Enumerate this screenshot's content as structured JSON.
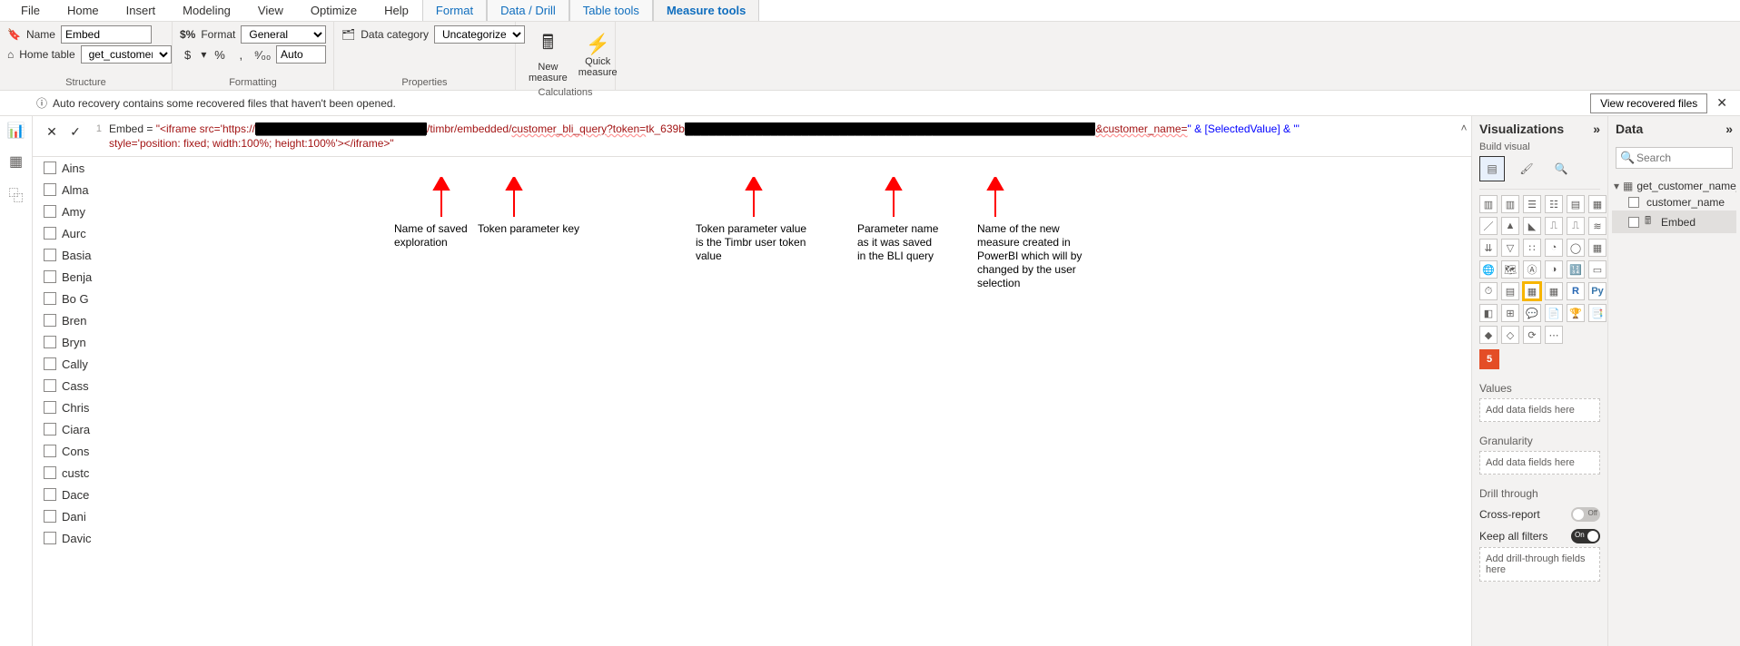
{
  "ribbon_tabs": {
    "file": "File",
    "home": "Home",
    "insert": "Insert",
    "modeling": "Modeling",
    "view": "View",
    "optimize": "Optimize",
    "help": "Help",
    "format": "Format",
    "data_drill": "Data / Drill",
    "table_tools": "Table tools",
    "measure_tools": "Measure tools"
  },
  "structure": {
    "name_label": "Name",
    "name_value": "Embed",
    "home_table_label": "Home table",
    "home_table_value": "get_customer_nam…",
    "group": "Structure"
  },
  "formatting": {
    "format_label": "Format",
    "format_value": "General",
    "currency": "$",
    "percent": "%",
    "comma": ",",
    "thousands": "⁹⁄₀₀",
    "decimals": "Auto",
    "group": "Formatting"
  },
  "properties": {
    "data_category_label": "Data category",
    "data_category_value": "Uncategorized",
    "group": "Properties"
  },
  "calculations": {
    "new_measure": "New\nmeasure",
    "quick_measure": "Quick\nmeasure",
    "group": "Calculations"
  },
  "recovery": {
    "msg": "Auto recovery contains some recovered files that haven't been opened.",
    "btn": "View recovered files"
  },
  "formula": {
    "line_no": "1",
    "prefix": "Embed = ",
    "str1": "\"<iframe src='https://",
    "redact1": "██████████████████████",
    "str2": "/timbr/embedded/",
    "str3": "customer_bli_query",
    "str4": "?token=",
    "str5": "tk_639b",
    "redact2": "█████████████████████████████████████████████████████",
    "str6": "&customer_name=",
    "str7": "\" & [SelectedValue] & \"'",
    "line2": "style='position: fixed; width:100%; height:100%'></iframe>\""
  },
  "annotations": {
    "a1": "Name of saved\nexploration",
    "a2": "Token parameter key",
    "a3": "Token parameter value\nis the Timbr user token\nvalue",
    "a4": "Parameter name\nas it was saved\nin the BLI query",
    "a5": "Name of the new\nmeasure created in\nPowerBI which will by\nchanged by the user\nselection"
  },
  "slicer_items": [
    "Ains",
    "Alma",
    "Amy",
    "Aurc",
    "Basia",
    "Benja",
    "Bo G",
    "Bren",
    "Bryn",
    "Cally",
    "Cass",
    "Chris",
    "Ciara",
    "Cons",
    "custc",
    "Dace",
    "Dani",
    "Davic"
  ],
  "viz": {
    "title": "Visualizations",
    "sub": "Build visual",
    "values": "Values",
    "values_ph": "Add data fields here",
    "gran": "Granularity",
    "gran_ph": "Add data fields here",
    "drill": "Drill through",
    "cross": "Cross-report",
    "keep": "Keep all filters",
    "drill_ph": "Add drill-through fields here",
    "off": "Off",
    "on": "On"
  },
  "data": {
    "title": "Data",
    "search_ph": "Search",
    "table": "get_customer_name_qu…",
    "field1": "customer_name",
    "field2": "Embed"
  }
}
